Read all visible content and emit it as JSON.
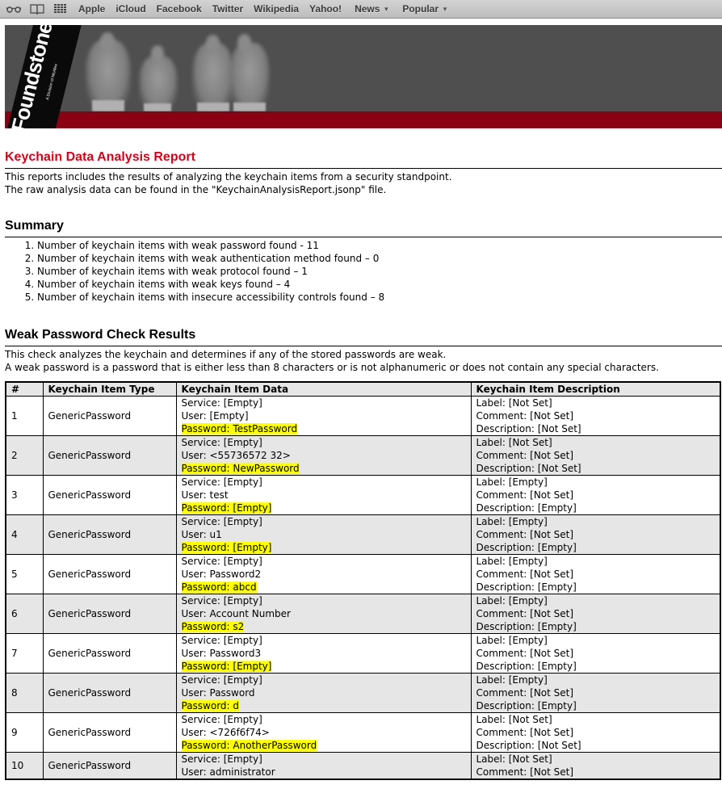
{
  "browser": {
    "bookmarks_bar": {
      "icons": [
        "reading-list-icon",
        "bookmarks-icon",
        "top-sites-icon"
      ],
      "links": [
        {
          "label": "Apple",
          "dropdown": false
        },
        {
          "label": "iCloud",
          "dropdown": false
        },
        {
          "label": "Facebook",
          "dropdown": false
        },
        {
          "label": "Twitter",
          "dropdown": false
        },
        {
          "label": "Wikipedia",
          "dropdown": false
        },
        {
          "label": "Yahoo!",
          "dropdown": false
        },
        {
          "label": "News",
          "dropdown": true
        },
        {
          "label": "Popular",
          "dropdown": true
        }
      ],
      "dropdown_glyph": "▼"
    }
  },
  "banner": {
    "logo": "Foundstone",
    "logo_subtitle": "A Division of McAfee",
    "colors": {
      "background": "#4f4f4f",
      "red_bar": "#8c0014"
    }
  },
  "report": {
    "title": "Keychain Data Analysis Report",
    "title_color": "#d0021b",
    "intro": [
      "This reports includes the results of analyzing the keychain items from a security standpoint.",
      "The raw analysis data can be found in the \"KeychainAnalysisReport.jsonp\" file."
    ],
    "summary": {
      "heading": "Summary",
      "items": [
        "Number of keychain items with weak password found - 11",
        "Number of keychain items with weak authentication method found – 0",
        "Number of keychain items with weak protocol found – 1",
        "Number of keychain items with weak keys found – 4",
        "Number of keychain items with insecure accessibility controls found – 8"
      ]
    },
    "weak_password": {
      "heading": "Weak Password Check Results",
      "description": [
        "This check analyzes the keychain and determines if any of the stored passwords are weak.",
        "A weak password is a password that is either less than 8 characters or is not alphanumeric or does not contain any special characters."
      ],
      "highlight_color": "#ffff00",
      "table": {
        "headers": [
          "#",
          "Keychain Item Type",
          "Keychain Item Data",
          "Keychain Item Description"
        ],
        "rows": [
          {
            "num": "1",
            "type": "GenericPassword",
            "service": "Service: [Empty]",
            "user": "User: [Empty]",
            "password": "Password: TestPassword",
            "label": "Label: [Not Set]",
            "comment": "Comment: [Not Set]",
            "description": "Description: [Not Set]"
          },
          {
            "num": "2",
            "type": "GenericPassword",
            "service": "Service: [Empty]",
            "user": "User: <55736572 32>",
            "password": "Password: NewPassword",
            "label": "Label: [Not Set]",
            "comment": "Comment: [Not Set]",
            "description": "Description: [Not Set]"
          },
          {
            "num": "3",
            "type": "GenericPassword",
            "service": "Service: [Empty]",
            "user": "User: test",
            "password": "Password: [Empty]",
            "label": "Label: [Empty]",
            "comment": "Comment: [Not Set]",
            "description": "Description: [Empty]"
          },
          {
            "num": "4",
            "type": "GenericPassword",
            "service": "Service: [Empty]",
            "user": "User: u1",
            "password": "Password: [Empty]",
            "label": "Label: [Empty]",
            "comment": "Comment: [Not Set]",
            "description": "Description: [Empty]"
          },
          {
            "num": "5",
            "type": "GenericPassword",
            "service": "Service: [Empty]",
            "user": "User: Password2",
            "password": "Password: abcd",
            "label": "Label: [Empty]",
            "comment": "Comment: [Not Set]",
            "description": "Description: [Empty]"
          },
          {
            "num": "6",
            "type": "GenericPassword",
            "service": "Service: [Empty]",
            "user": "User: Account Number",
            "password": "Password: s2",
            "label": "Label: [Empty]",
            "comment": "Comment: [Not Set]",
            "description": "Description: [Empty]"
          },
          {
            "num": "7",
            "type": "GenericPassword",
            "service": "Service: [Empty]",
            "user": "User: Password3",
            "password": "Password: [Empty]",
            "label": "Label: [Empty]",
            "comment": "Comment: [Not Set]",
            "description": "Description: [Empty]"
          },
          {
            "num": "8",
            "type": "GenericPassword",
            "service": "Service: [Empty]",
            "user": "User: Password",
            "password": "Password: d",
            "label": "Label: [Empty]",
            "comment": "Comment: [Not Set]",
            "description": "Description: [Empty]"
          },
          {
            "num": "9",
            "type": "GenericPassword",
            "service": "Service: [Empty]",
            "user": "User: <726f6f74>",
            "password": "Password: AnotherPassword",
            "label": "Label: [Not Set]",
            "comment": "Comment: [Not Set]",
            "description": "Description: [Not Set]"
          },
          {
            "num": "10",
            "type": "GenericPassword",
            "service": "Service: [Empty]",
            "user": "User: administrator",
            "password": "",
            "label": "Label: [Not Set]",
            "comment": "Comment: [Not Set]",
            "description": ""
          }
        ]
      }
    }
  }
}
